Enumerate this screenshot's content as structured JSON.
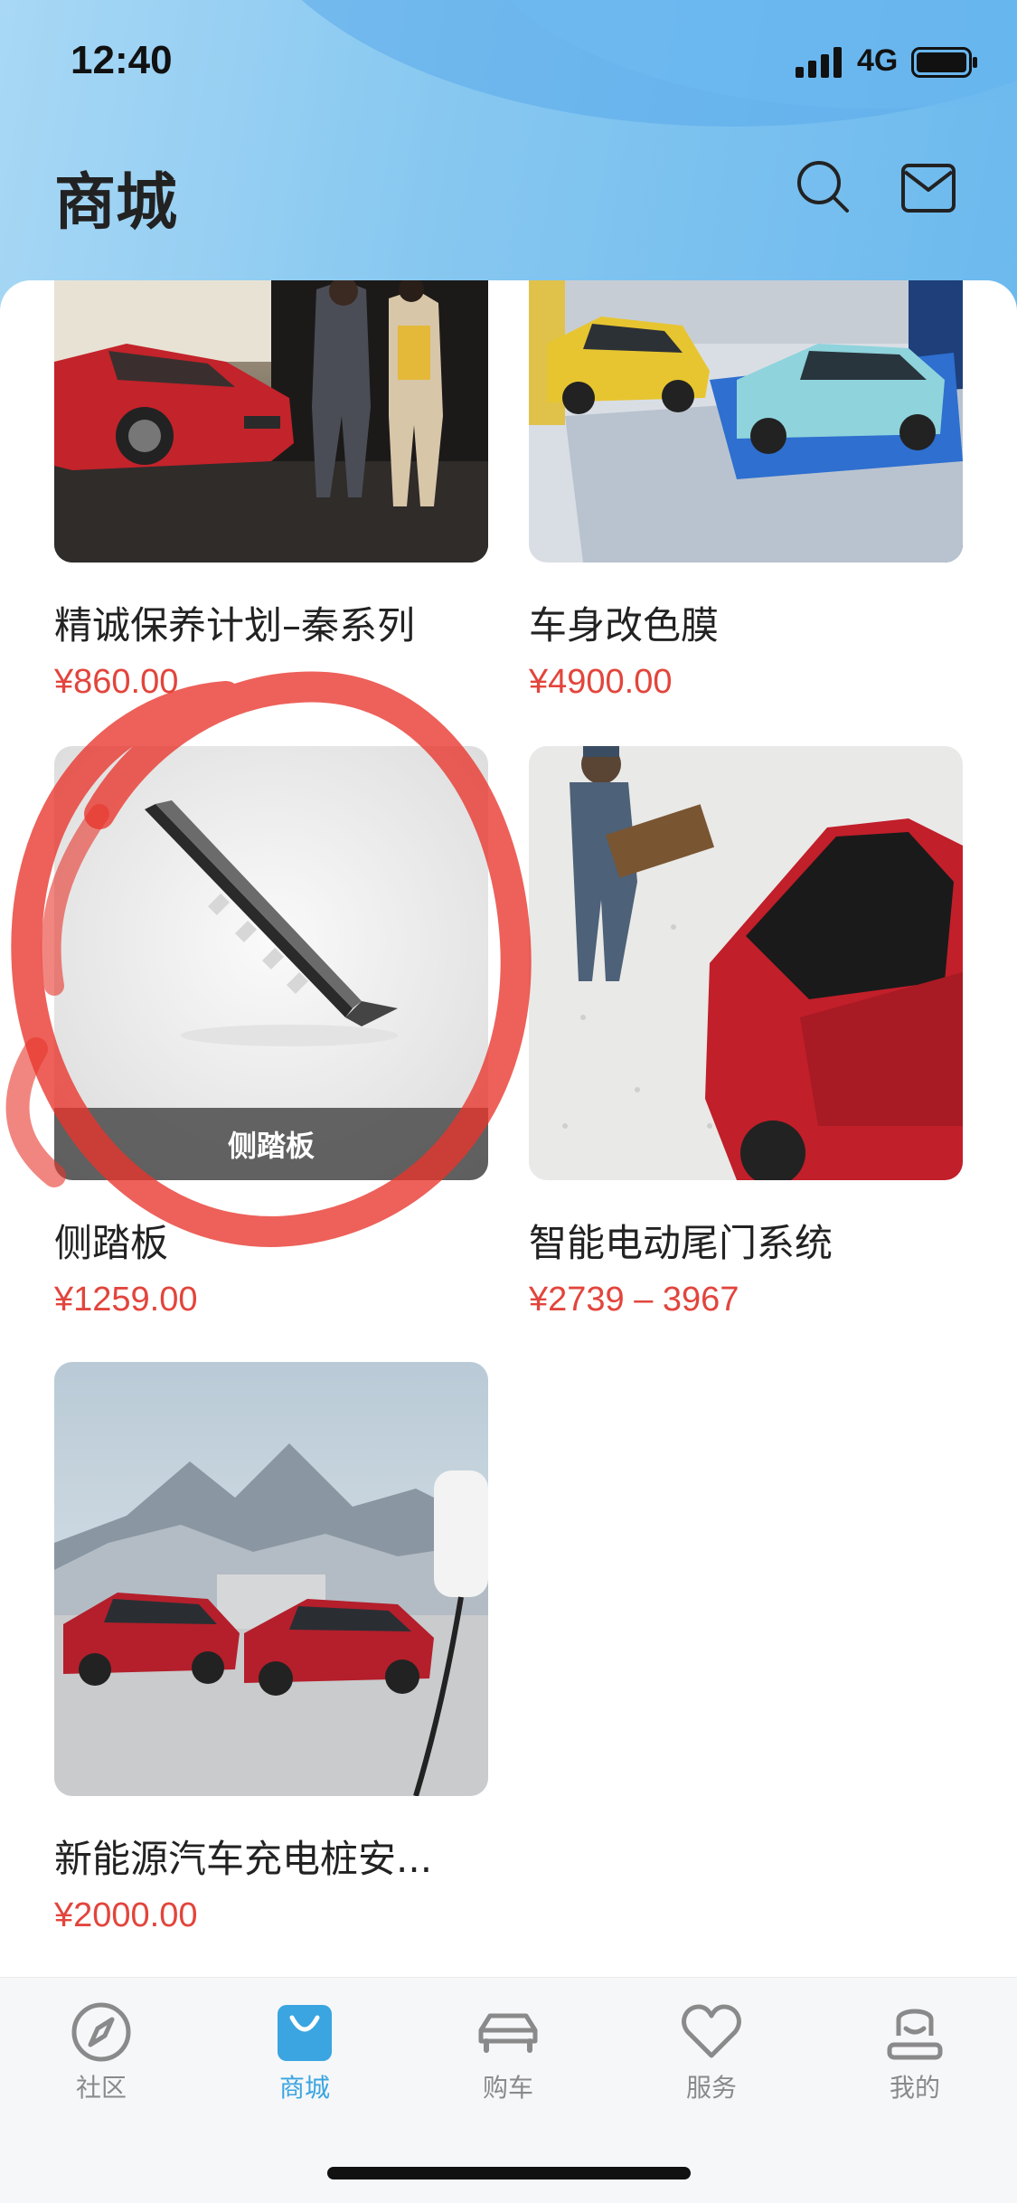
{
  "status_bar": {
    "time": "12:40",
    "network": "4G"
  },
  "header": {
    "title": "商城"
  },
  "products": [
    {
      "name": "精诚保养计划–秦系列",
      "price": "¥860.00",
      "overlay": ""
    },
    {
      "name": "车身改色膜",
      "price": "¥4900.00",
      "overlay": ""
    },
    {
      "name": "侧踏板",
      "price": "¥1259.00",
      "overlay": "侧踏板"
    },
    {
      "name": "智能电动尾门系统",
      "price": "¥2739 – 3967",
      "overlay": ""
    },
    {
      "name": "新能源汽车充电桩安...",
      "price": "¥2000.00",
      "overlay": ""
    }
  ],
  "tabbar": {
    "tabs": [
      {
        "label": "社区",
        "icon": "compass-icon"
      },
      {
        "label": "商城",
        "icon": "shopping-bag-icon"
      },
      {
        "label": "购车",
        "icon": "car-icon"
      },
      {
        "label": "服务",
        "icon": "heart-icon"
      },
      {
        "label": "我的",
        "icon": "profile-icon"
      }
    ],
    "active_index": 1
  },
  "colors": {
    "accent": "#3aa5e0",
    "price": "#e2453c",
    "annotation": "#e8352b"
  }
}
